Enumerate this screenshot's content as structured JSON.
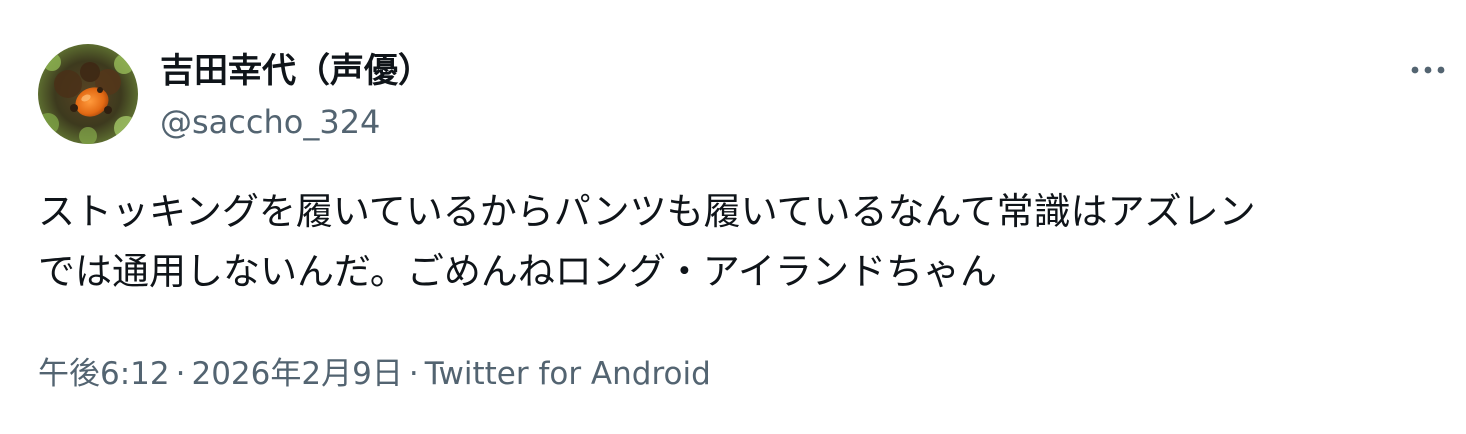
{
  "author": {
    "display_name": "吉田幸代（声優）",
    "handle": "@saccho_324",
    "avatar_icon": "avatar-photo-icon"
  },
  "actions": {
    "more_icon": "more-horizontal-icon"
  },
  "tweet": {
    "text_line_1": "ストッキングを履いているからパンツも履いているなんて常識はアズレン",
    "text_line_2": "では通用しないんだ。ごめんねロング・アイランドちゃん"
  },
  "meta": {
    "time": "午後6:12",
    "separator": "·",
    "date": "2026年2月9日",
    "source": "Twitter for Android"
  },
  "colors": {
    "text_primary": "#0f1419",
    "text_secondary": "#536471",
    "background": "#ffffff"
  }
}
